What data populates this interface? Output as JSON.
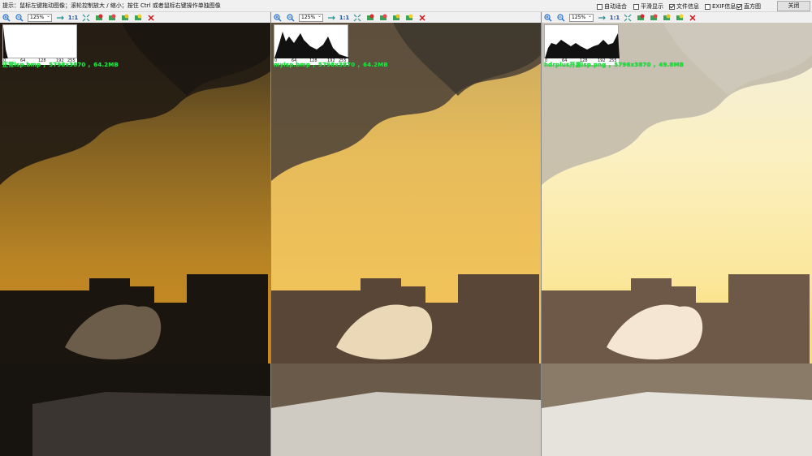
{
  "topbar": {
    "hint": "提示：鼠标左键拖动图像；滚轮控制放大 / 缩小；按住 Ctrl 或者鼠标右键操作单独图像",
    "options": [
      {
        "label": "自动适合",
        "checked": false
      },
      {
        "label": "平滑显示",
        "checked": false
      },
      {
        "label": "文件信息",
        "checked": true
      },
      {
        "label": "EXIF信息",
        "checked": false
      },
      {
        "label": "直方图",
        "checked": true
      }
    ],
    "close_label": "关闭"
  },
  "toolbar": {
    "zoom_value": "125%",
    "one_to_one_label": "1:1",
    "icons": [
      "zoom-in-icon",
      "zoom-out-icon",
      "fit-icon",
      "actual-size-icon",
      "fullscreen-icon",
      "red-image-icon",
      "green-image-icon",
      "yellow-image-icon",
      "prev-image-icon",
      "close-icon"
    ]
  },
  "histogram_ticks": [
    "0",
    "64",
    "128",
    "192",
    "255"
  ],
  "panes": [
    {
      "file_info": "正常isp.bmp ，5798x3870 ，64.2MB",
      "tone": "dark"
    },
    {
      "file_info": "myisp.bmp ，5798x3870 ，64.2MB",
      "tone": "mid"
    },
    {
      "file_info": "hdrplus开源isp.png ，5796x3870 ，49.8MB",
      "tone": "bright"
    }
  ],
  "colors": {
    "accent_info": "#1fe23a",
    "close_x": "#d01010",
    "zoom_icon": "#1e6fd0"
  }
}
